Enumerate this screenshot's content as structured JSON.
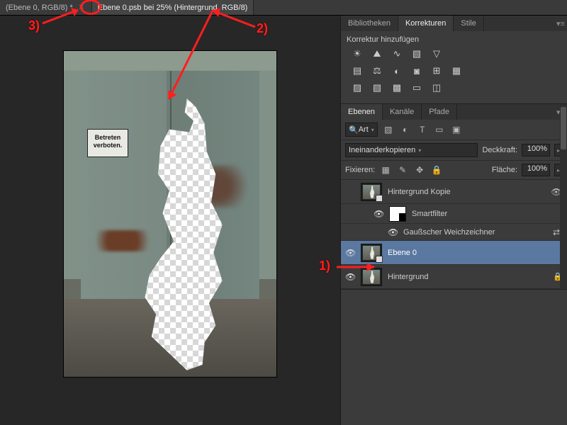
{
  "tabs": [
    {
      "label": "(Ebene 0, RGB/8) *",
      "active": false
    },
    {
      "label": "Ebene 0.psb bei 25% (Hintergrund, RGB/8)",
      "active": true
    }
  ],
  "sign_line1": "Betreten",
  "sign_line2": "verboten.",
  "panel_groups": {
    "top": {
      "tabs": [
        "Bibliotheken",
        "Korrekturen",
        "Stile"
      ],
      "active": 1
    },
    "layers": {
      "tabs": [
        "Ebenen",
        "Kanäle",
        "Pfade"
      ],
      "active": 0
    }
  },
  "adjustments_title": "Korrektur hinzufügen",
  "layer_panel": {
    "filter_label": "Art",
    "blend_mode": "Ineinanderkopieren",
    "opacity_label": "Deckkraft:",
    "opacity_value": "100%",
    "lock_label": "Fixieren:",
    "fill_label": "Fläche:",
    "fill_value": "100%"
  },
  "layers": [
    {
      "name": "Hintergrund Kopie",
      "eye": "",
      "smart": true
    },
    {
      "name": "Smartfilter",
      "eye": "👁",
      "sub": true,
      "mask": true
    },
    {
      "name": "Gaußscher Weichzeichner",
      "eye": "👁",
      "sub2": true
    },
    {
      "name": "Ebene 0",
      "eye": "👁",
      "selected": true,
      "smart": true
    },
    {
      "name": "Hintergrund",
      "eye": "👁",
      "locked": true
    }
  ],
  "annos": {
    "a1": "1)",
    "a2": "2)",
    "a3": "3)"
  }
}
